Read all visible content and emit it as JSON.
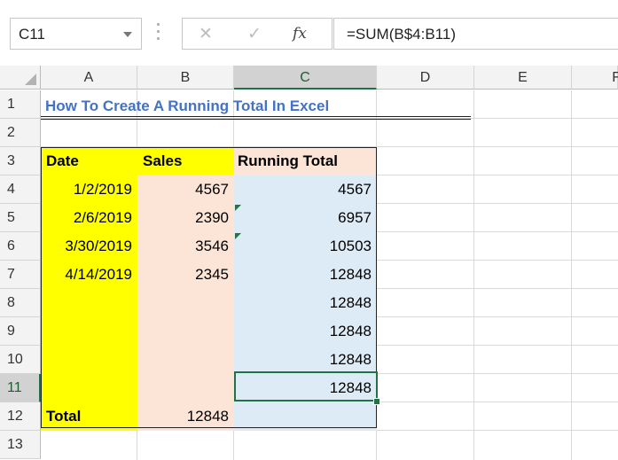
{
  "formula_bar": {
    "name_box": "C11",
    "cancel_icon": "✕",
    "enter_icon": "✓",
    "fx_icon": "fx",
    "formula": "=SUM(B$4:B11)"
  },
  "columns": [
    "A",
    "B",
    "C",
    "D",
    "E",
    "F"
  ],
  "rows": [
    "1",
    "2",
    "3",
    "4",
    "5",
    "6",
    "7",
    "8",
    "9",
    "10",
    "11",
    "12",
    "13"
  ],
  "sheet": {
    "title": "How To Create A Running Total In Excel",
    "headers": {
      "date": "Date",
      "sales": "Sales",
      "running_total": "Running Total"
    },
    "data": [
      {
        "date": "1/2/2019",
        "sales": "4567",
        "total": "4567"
      },
      {
        "date": "2/6/2019",
        "sales": "2390",
        "total": "6957"
      },
      {
        "date": "3/30/2019",
        "sales": "3546",
        "total": "10503"
      },
      {
        "date": "4/14/2019",
        "sales": "2345",
        "total": "12848"
      },
      {
        "date": "",
        "sales": "",
        "total": "12848"
      },
      {
        "date": "",
        "sales": "",
        "total": "12848"
      },
      {
        "date": "",
        "sales": "",
        "total": "12848"
      },
      {
        "date": "",
        "sales": "",
        "total": "12848"
      }
    ],
    "total_row": {
      "label": "Total",
      "sales": "12848"
    }
  },
  "colors": {
    "yellow": "#ffff00",
    "peach": "#fce4d6",
    "blue": "#ddebf7",
    "title": "#4472c4",
    "selection": "#217346"
  }
}
